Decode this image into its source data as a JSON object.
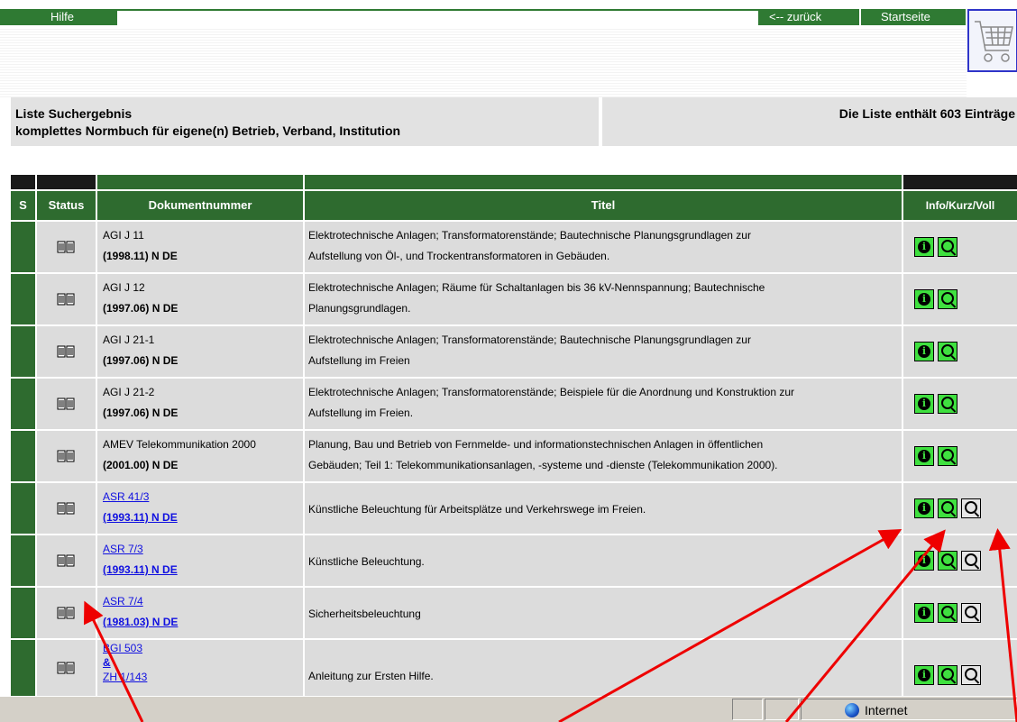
{
  "nav": {
    "help": "Hilfe",
    "back": "<-- zurück",
    "home": "Startseite"
  },
  "header": {
    "title": "Liste Suchergebnis",
    "subtitle": "komplettes Normbuch für eigene(n) Betrieb, Verband, Institution",
    "count": "Die Liste enthält 603 Einträge"
  },
  "table": {
    "columns": [
      "S",
      "Status",
      "Dokumentnummer",
      "Titel",
      "Info/Kurz/Voll"
    ],
    "rows": [
      {
        "doc": "AGI J 11",
        "edition": "(1998.11) N DE",
        "title1": "Elektrotechnische Anlagen; Transformatorenstände; Bautechnische Planungsgrundlagen zur",
        "title2": "Aufstellung von Öl-, und Trockentransformatoren in Gebäuden."
      },
      {
        "doc": "AGI J 12",
        "edition": "(1997.06) N DE",
        "title1": "Elektrotechnische Anlagen; Räume für Schaltanlagen bis 36 kV-Nennspannung; Bautechnische",
        "title2": "Planungsgrundlagen."
      },
      {
        "doc": "AGI J 21-1",
        "edition": "(1997.06) N DE",
        "title1": "Elektrotechnische Anlagen; Transformatorenstände; Bautechnische Planungsgrundlagen zur",
        "title2": "Aufstellung im Freien"
      },
      {
        "doc": "AGI J 21-2",
        "edition": "(1997.06) N DE",
        "title1": "Elektrotechnische Anlagen; Transformatorenstände; Beispiele für die Anordnung und Konstruktion zur",
        "title2": "Aufstellung im Freien."
      },
      {
        "doc": "AMEV Telekommunikation 2000",
        "edition": "(2001.00) N DE",
        "title1": "Planung, Bau und Betrieb von Fernmelde- und informationstechnischen Anlagen in öffentlichen",
        "title2": "Gebäuden; Teil 1: Telekommunikationsanlagen, -systeme und -dienste (Telekommunikation 2000)."
      },
      {
        "doc": "ASR 41/3",
        "edition": "(1993.11) N DE",
        "title": "Künstliche Beleuchtung für Arbeitsplätze und Verkehrswege im Freien."
      },
      {
        "doc": "ASR 7/3",
        "edition": "(1993.11) N DE",
        "title": "Künstliche Beleuchtung."
      },
      {
        "doc": "ASR 7/4",
        "edition": "(1981.03) N DE",
        "title": "Sicherheitsbeleuchtung"
      },
      {
        "doc": "BGI 503",
        "doc_amp": "&",
        "doc_alt": "ZH 1/143",
        "title": "Anleitung zur Ersten Hilfe."
      }
    ]
  },
  "buttons": {
    "info_letter": "i"
  },
  "statusbar": {
    "zone": "Internet"
  },
  "icons": [
    "shopping-cart-icon",
    "book-status-icon",
    "info-icon",
    "magnifier-icon",
    "internet-globe-icon"
  ],
  "colors": {
    "nav_green": "#2f7a33",
    "header_green": "#2e6b2f",
    "button_green": "#3fe03f",
    "link_blue": "#1010e0",
    "annotation_red": "#ee0000"
  }
}
